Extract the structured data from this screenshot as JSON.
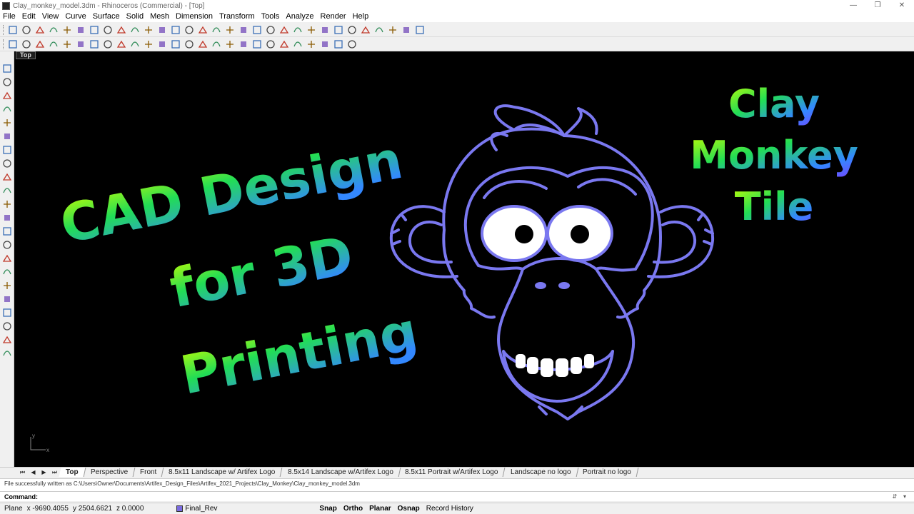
{
  "window": {
    "title": "Clay_monkey_model.3dm - Rhinoceros (Commercial) - [Top]",
    "minimize": "—",
    "maximize": "❐",
    "close": "✕"
  },
  "menu": [
    "File",
    "Edit",
    "View",
    "Curve",
    "Surface",
    "Solid",
    "Mesh",
    "Dimension",
    "Transform",
    "Tools",
    "Analyze",
    "Render",
    "Help"
  ],
  "toolbar1_icons": [
    "new-file-icon",
    "open-file-icon",
    "save-icon",
    "print-icon",
    "import-icon",
    "cut-icon",
    "copy-icon",
    "paste-icon",
    "undo-icon",
    "pan-icon",
    "zoom-icon",
    "zoom-window-icon",
    "zoom-extents-icon",
    "rotate-view-icon",
    "four-viewports-icon",
    "car-icon",
    "render-icon",
    "light-icon",
    "lock-icon",
    "material-icon",
    "color-wheel-icon",
    "shade-icon",
    "sphere-icon",
    "gear-icon",
    "help-icon",
    "point-icon",
    "curve-icon",
    "text-icon",
    "dimension-icon",
    "grid-icon",
    "snap-icon"
  ],
  "toolbar2_icons": [
    "line-icon",
    "polyline-icon",
    "arc-icon",
    "circle-icon",
    "ellipse-icon",
    "rectangle-icon",
    "polygon-icon",
    "curve-point-icon",
    "fillet-icon",
    "trim-icon",
    "split-icon",
    "join-icon",
    "explode-icon",
    "offset-icon",
    "mirror-icon",
    "array-icon",
    "scale-icon",
    "move-icon",
    "boolean-icon",
    "extrude-icon",
    "loft-icon",
    "sweep-icon",
    "revolve-icon",
    "cap-icon",
    "shell-icon",
    "layout-icon"
  ],
  "left_toolbar_icons": [
    "select-icon",
    "point-icon",
    "polyline-icon",
    "circle-icon",
    "rectangle-icon",
    "curve-icon",
    "surface-icon",
    "solid-icon",
    "extrude-icon",
    "mesh-icon",
    "dimension-icon",
    "transform-icon",
    "align-icon",
    "array-icon",
    "boolean-icon",
    "cursor-icon",
    "analyze-icon",
    "history-icon",
    "render-icon",
    "material-icon",
    "layer-icon",
    "cube-icon"
  ],
  "viewport": {
    "label": "Top",
    "text_left_lines": [
      "CAD Design",
      "for 3D",
      "Printing"
    ],
    "text_right_lines": [
      "Clay",
      "Monkey",
      "Tile"
    ],
    "axis_y": "y",
    "axis_x": "x",
    "colors": {
      "background": "#000000",
      "monkey_outline": "#7a78f0",
      "gradient_start": "#c8ff00",
      "gradient_mid": "#22dd55",
      "gradient_end": "#3388ff",
      "gradient_violet": "#7744ff"
    }
  },
  "view_tabs": [
    "Top",
    "Perspective",
    "Front",
    "8.5x11 Landscape  w/ Artifex Logo",
    "8.5x14 Landscape w/Artifex Logo",
    "8.5x11 Portrait w/Artifex Logo",
    "Landscape no logo",
    "Portrait no logo"
  ],
  "active_tab": "Top",
  "history_text": "File successfully written as C:\\Users\\Owner\\Documents\\Artifex_Design_Files\\Artifex_2021_Projects\\Clay_Monkey\\Clay_monkey_model.3dm",
  "command": {
    "label": "Command:",
    "value": ""
  },
  "status": {
    "plane": "Plane",
    "x": "x -9690.4055",
    "y": "y 2504.6621",
    "z": "z 0.0000",
    "layer": "Final_Rev",
    "snap": "Snap",
    "ortho": "Ortho",
    "planar": "Planar",
    "osnap": "Osnap",
    "record_history": "Record History"
  }
}
